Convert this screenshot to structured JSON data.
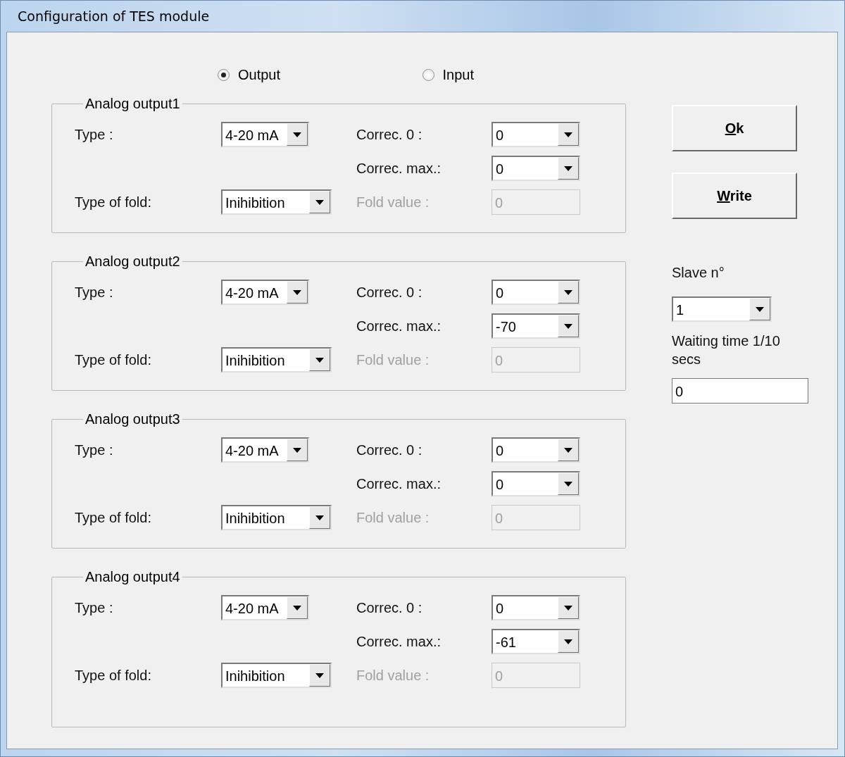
{
  "window": {
    "title": "Configuration of TES module"
  },
  "mode_radios": [
    {
      "label": "Output",
      "selected": true
    },
    {
      "label": "Input",
      "selected": false
    }
  ],
  "groups": [
    {
      "title": "Analog output1",
      "type_label": "Type :",
      "type_value": "4-20 mA",
      "fold_label": "Type of fold:",
      "fold_value": "Inihibition",
      "correc0_label": "Correc. 0  :",
      "correc0_value": "0",
      "correcmax_label": "Correc. max.:",
      "correcmax_value": "0",
      "foldval_label": "Fold value  :",
      "foldval_value": "0",
      "foldval_disabled": true
    },
    {
      "title": "Analog output2",
      "type_label": "Type :",
      "type_value": "4-20 mA",
      "fold_label": "Type of fold:",
      "fold_value": "Inihibition",
      "correc0_label": "Correc. 0  :",
      "correc0_value": "0",
      "correcmax_label": "Correc. max.:",
      "correcmax_value": "-70",
      "foldval_label": "Fold value  :",
      "foldval_value": "0",
      "foldval_disabled": true
    },
    {
      "title": "Analog output3",
      "type_label": "Type :",
      "type_value": "4-20 mA",
      "fold_label": "Type of fold:",
      "fold_value": "Inihibition",
      "correc0_label": "Correc. 0  :",
      "correc0_value": "0",
      "correcmax_label": "Correc. max.:",
      "correcmax_value": "0",
      "foldval_label": "Fold value  :",
      "foldval_value": "0",
      "foldval_disabled": true
    },
    {
      "title": "Analog output4",
      "type_label": "Type :",
      "type_value": "4-20 mA",
      "fold_label": "Type of fold:",
      "fold_value": "Inihibition",
      "correc0_label": "Correc. 0  :",
      "correc0_value": "0",
      "correcmax_label": "Correc. max.:",
      "correcmax_value": "-61",
      "foldval_label": "Fold value  :",
      "foldval_value": "0",
      "foldval_disabled": true
    }
  ],
  "buttons": [
    {
      "label": "Ok"
    },
    {
      "label": "Write"
    }
  ],
  "slave": {
    "label": "Slave n°",
    "value": "1"
  },
  "waiting": {
    "label": "Waiting time 1/10 secs",
    "value": "0"
  }
}
